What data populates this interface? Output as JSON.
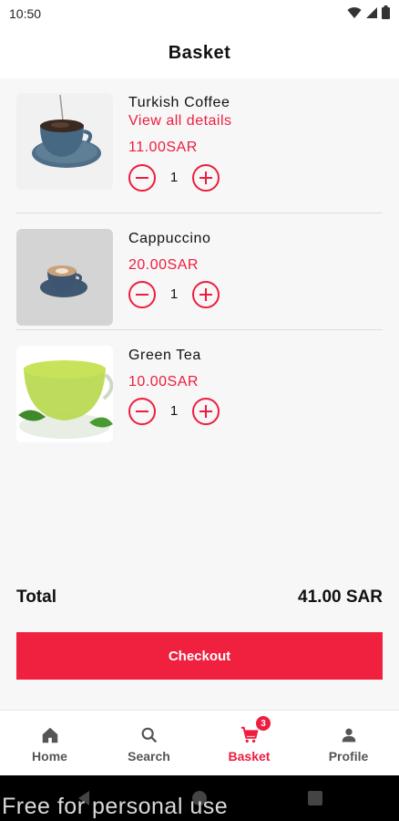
{
  "status_bar": {
    "time": "10:50"
  },
  "header": {
    "title": "Basket"
  },
  "items": [
    {
      "name": "Turkish Coffee",
      "link": "View all details",
      "price": "11.00SAR",
      "qty": "1"
    },
    {
      "name": "Cappuccino",
      "price": "20.00SAR",
      "qty": "1"
    },
    {
      "name": "Green Tea",
      "price": "10.00SAR",
      "qty": "1"
    }
  ],
  "summary": {
    "total_label": "Total",
    "total_value": "41.00 SAR"
  },
  "checkout": {
    "label": "Checkout"
  },
  "nav": {
    "items": [
      {
        "label": "Home",
        "icon": "home-icon"
      },
      {
        "label": "Search",
        "icon": "search-icon"
      },
      {
        "label": "Basket",
        "icon": "cart-icon",
        "badge": "3",
        "active": true
      },
      {
        "label": "Profile",
        "icon": "person-icon"
      }
    ]
  },
  "watermark": "Free for personal use",
  "colors": {
    "accent": "#ee1d3e",
    "background": "#f7f7f7",
    "nav_background": "#ffffff"
  }
}
